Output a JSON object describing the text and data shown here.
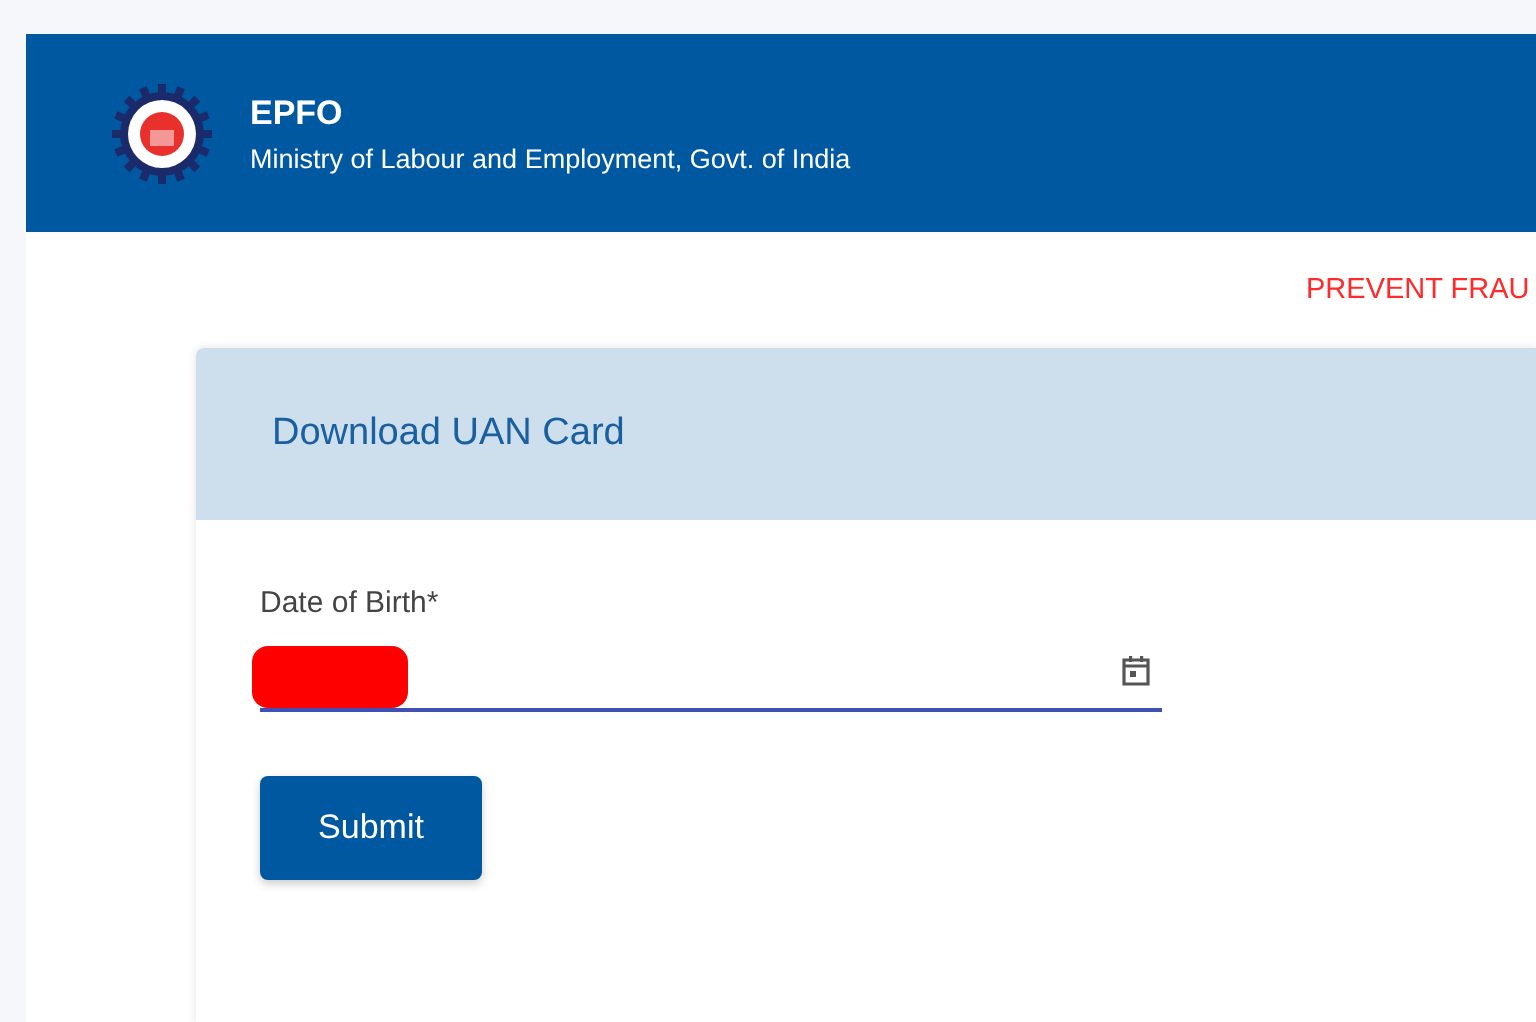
{
  "header": {
    "title": "EPFO",
    "subtitle": "Ministry of Labour and Employment, Govt. of India"
  },
  "notice": "PREVENT FRAU",
  "card": {
    "title": "Download UAN Card",
    "fields": [
      {
        "label": "Date of Birth*",
        "kind": "date",
        "redacted": true
      }
    ],
    "buttons": [
      "Submit"
    ]
  }
}
